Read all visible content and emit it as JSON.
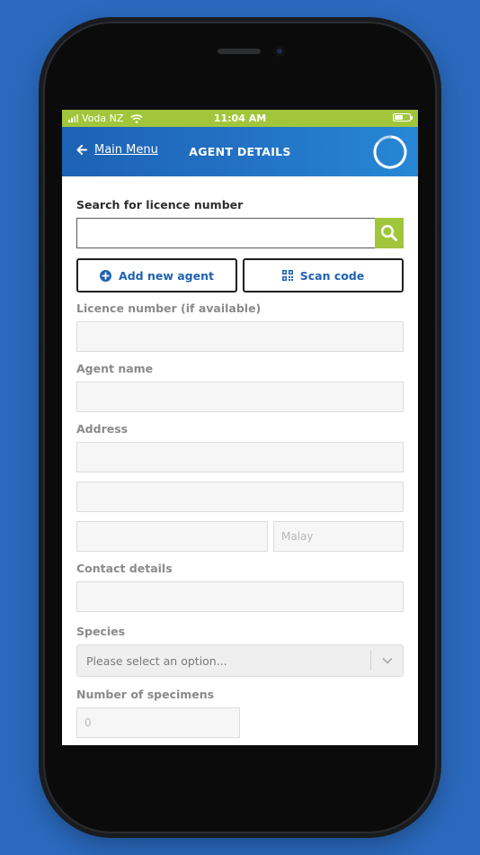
{
  "status_bar": {
    "carrier": "Voda NZ",
    "time": "11:04 AM"
  },
  "header": {
    "back_label": "Main Menu",
    "title": "AGENT DETAILS"
  },
  "search": {
    "label": "Search for licence number",
    "value": ""
  },
  "actions": {
    "add_agent_label": "Add new agent",
    "scan_code_label": "Scan code"
  },
  "form": {
    "licence_label": "Licence number (if available)",
    "agent_name_label": "Agent name",
    "address_label": "Address",
    "address_country_placeholder": "Malay",
    "contact_label": "Contact details",
    "species_label": "Species",
    "species_selected": "Please select an option...",
    "specimens_label": "Number of specimens",
    "specimens_placeholder": "0"
  },
  "colors": {
    "accent_green": "#a1c63b",
    "header_blue": "#1d62b4",
    "background_blue": "#2a69bd",
    "link_blue": "#1f62b0"
  }
}
